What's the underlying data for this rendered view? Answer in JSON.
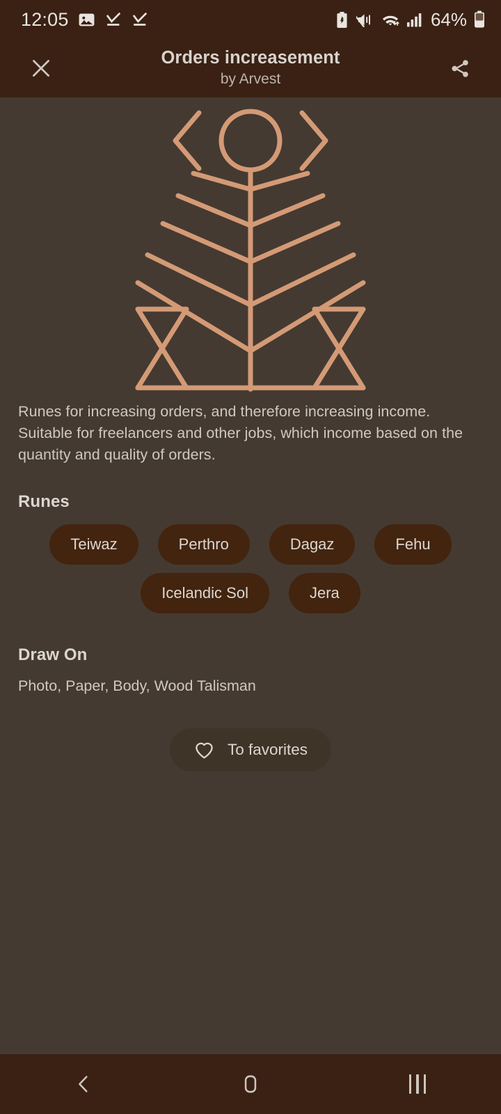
{
  "colors": {
    "header_bg": "#3A2114",
    "body_bg": "#443A31",
    "chip_bg": "#42240F",
    "sigil_stroke": "#D49A76",
    "text_primary": "#DCD6D0",
    "text_secondary": "#CFC8C1",
    "nav_icon": "#CDC6BF"
  },
  "status_bar": {
    "time": "12:05",
    "battery_percent": "64%",
    "left_icons": [
      "gallery-image-icon",
      "download-complete-icon",
      "download-complete-icon"
    ],
    "right_icons": [
      "battery-saver-icon",
      "mute-vibrate-icon",
      "wifi-icon",
      "cellular-signal-icon",
      "battery-icon"
    ]
  },
  "header": {
    "close_label": "close-icon",
    "title": "Orders increasement",
    "subtitle": "by Arvest",
    "share_label": "share-icon"
  },
  "sigil": {
    "name": "rune-sigil-illustration",
    "description": "Stylized runic tree sigil: circle head, chevrons, chevron branches, baseline with two hourglass Dagaz runes"
  },
  "main": {
    "description": "Runes for increasing orders,  and therefore increasing income.  Suitable for freelancers and other jobs,  which income based on the quantity and quality of orders.",
    "runes_heading": "Runes",
    "runes": [
      [
        "Teiwaz",
        "Perthro",
        "Dagaz",
        "Fehu"
      ],
      [
        "Icelandic Sol",
        "Jera"
      ]
    ],
    "draw_on_heading": "Draw On",
    "draw_on_text": "Photo, Paper, Body, Wood Talisman",
    "favorites_label": "To favorites",
    "favorites_icon": "heart-outline-icon"
  },
  "nav_bar": {
    "back_label": "back-icon",
    "home_label": "home-icon",
    "recents_label": "recents-icon"
  }
}
